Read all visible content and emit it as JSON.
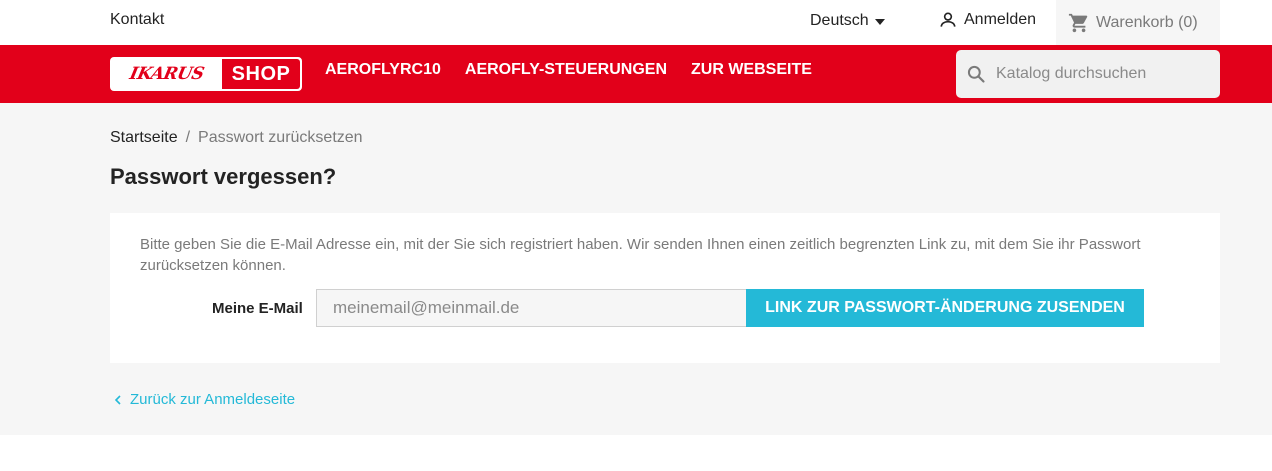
{
  "topbar": {
    "contact": "Kontakt",
    "language": "Deutsch",
    "signin": "Anmelden",
    "cart": "Warenkorb (0)"
  },
  "header": {
    "logo_left": "IKARUS",
    "logo_right": "SHOP",
    "nav": [
      "AEROFLYRC10",
      "AEROFLY-STEUERUNGEN",
      "ZUR WEBSEITE"
    ],
    "search_placeholder": "Katalog durchsuchen"
  },
  "breadcrumb": {
    "home": "Startseite",
    "separator": "/",
    "current": "Passwort zurücksetzen"
  },
  "page": {
    "title": "Passwort vergessen?",
    "info": "Bitte geben Sie die E-Mail Adresse ein, mit der Sie sich registriert haben. Wir senden Ihnen einen zeitlich begrenzten Link zu, mit dem Sie ihr Passwort zurücksetzen können.",
    "email_label": "Meine E-Mail",
    "email_placeholder": "meinemail@meinmail.de",
    "submit_label": "LINK ZUR PASSWORT-ÄNDERUNG ZUSENDEN",
    "back_link": "Zurück zur Anmeldeseite"
  },
  "colors": {
    "brand_red": "#e2001a",
    "accent_blue": "#24b9d7",
    "background": "#f6f6f6"
  }
}
